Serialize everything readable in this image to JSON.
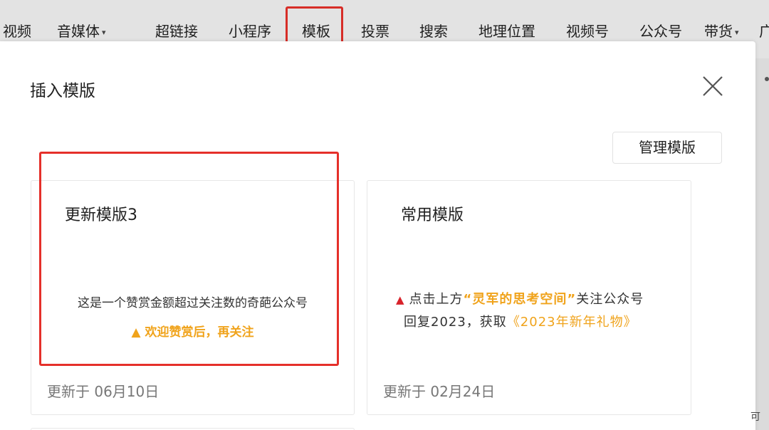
{
  "toolbar": {
    "items": [
      "视频",
      "音媒体",
      "超链接",
      "小程序",
      "模板",
      "投票",
      "搜索",
      "地理位置",
      "视频号",
      "公众号",
      "带货",
      "广"
    ],
    "dropdown_caret": "▾"
  },
  "dialog": {
    "title": "插入模版",
    "manage_label": "管理模版"
  },
  "templates": [
    {
      "title": "更新模版3",
      "preview_line1": "这是一个赞赏金额超过关注数的奇葩公众号",
      "preview_line2": "▲ 欢迎赞赏后，再关注",
      "updated": "更新于 06月10日"
    },
    {
      "title": "常用模版",
      "preview_triangle": "▲",
      "preview_a": "点击上方",
      "preview_b": "“灵军的思考空间”",
      "preview_c": "关注公众号",
      "preview_d": "回复2023，获取",
      "preview_e": "《2023年新年礼物》",
      "updated": "更新于 02月24日"
    }
  ],
  "corner_char": "可",
  "colors": {
    "highlight_red": "#e5302a",
    "accent_orange": "#f0a31b",
    "triangle_red": "#d8222a"
  }
}
